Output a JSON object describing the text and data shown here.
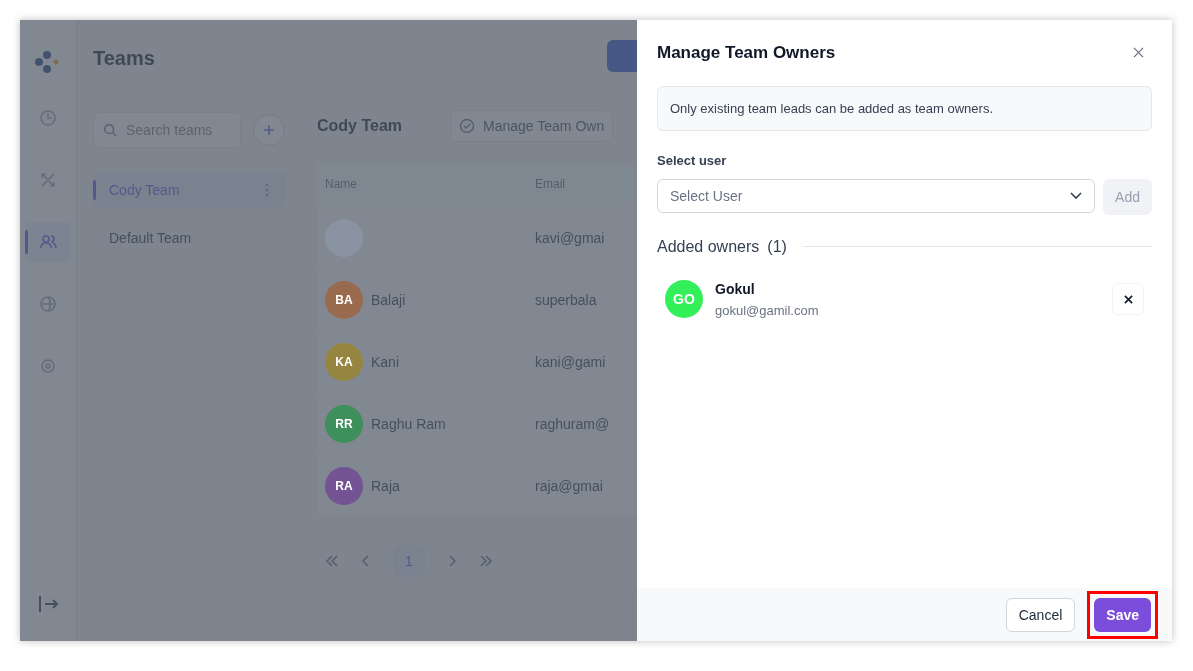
{
  "nav": [
    {
      "kind": "clock",
      "selected": false
    },
    {
      "kind": "cross",
      "selected": false
    },
    {
      "kind": "users",
      "selected": true
    },
    {
      "kind": "globe",
      "selected": false
    },
    {
      "kind": "gear",
      "selected": false
    }
  ],
  "page": {
    "title": "Teams"
  },
  "teams": {
    "search_placeholder": "Search teams",
    "items": [
      {
        "label": "Cody Team",
        "selected": true
      },
      {
        "label": "Default Team",
        "selected": false
      }
    ]
  },
  "team_view": {
    "title": "Cody Team",
    "manage_button": "Manage Team Own",
    "columns": [
      "Name",
      "Email"
    ],
    "rows": [
      {
        "initials": "",
        "name": "",
        "email": "kavi@gmai",
        "color": "#8a93a2"
      },
      {
        "initials": "BA",
        "name": "Balaji",
        "email": "superbala",
        "color": "#9a6a4e"
      },
      {
        "initials": "KA",
        "name": "Kani",
        "email": "kani@gami",
        "color": "#958540"
      },
      {
        "initials": "RR",
        "name": "Raghu Ram",
        "email": "raghuram@",
        "color": "#3f8f5c"
      },
      {
        "initials": "RA",
        "name": "Raja",
        "email": "raja@gmai",
        "color": "#735394"
      }
    ],
    "pages": [
      {
        "label": "1",
        "selected": true
      }
    ]
  },
  "modal": {
    "title": "Manage Team Owners",
    "notice": "Only existing team leads can be added as team owners.",
    "select_label": "Select user",
    "select_placeholder": "Select User",
    "add_button": "Add",
    "add_disabled": true,
    "owners_heading": "Added owners",
    "owners_count": "(1)",
    "owners": [
      {
        "initials": "GO",
        "name": "Gokul",
        "email": "gokul@gamil.com",
        "color": "#33f05a"
      }
    ],
    "cancel": "Cancel",
    "save": "Save",
    "save_highlighted": true
  }
}
